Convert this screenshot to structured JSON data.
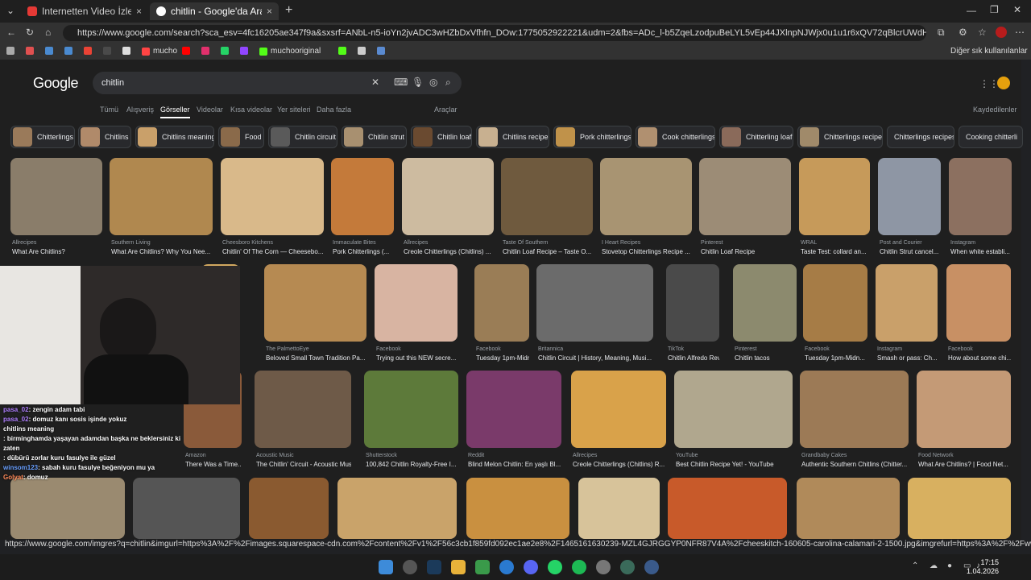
{
  "browser": {
    "tabs": [
      {
        "title": "Internetten Video İzleyerek Yemek",
        "close": "×"
      },
      {
        "title": "chitlin - Google'da Ara",
        "close": "×"
      }
    ],
    "new_tab": "+",
    "url": "https://www.google.com/search?sca_esv=4fc16205ae347f9a&sxsrf=ANbL-n5-ioYn2jvADC3wHZbDxVfhfn_DOw:1775052922221&udm=2&fbs=ADc_l-b5ZqeLzodpuBeLYL5vEp44JXlnpNJWjx0u1u1r6xQV72qBlcrUWdHOeoPCw88I-KlkkbCJM6Art9Ds...",
    "bookmarks": [
      {
        "label": ""
      },
      {
        "label": ""
      },
      {
        "label": ""
      },
      {
        "label": ""
      },
      {
        "label": ""
      },
      {
        "label": ""
      },
      {
        "label": ""
      },
      {
        "label": "mucho"
      },
      {
        "label": ""
      },
      {
        "label": ""
      },
      {
        "label": ""
      },
      {
        "label": ""
      },
      {
        "label": "muchooriginal"
      },
      {
        "label": ""
      },
      {
        "label": ""
      },
      {
        "label": ""
      }
    ],
    "other_bookmarks": "Diğer sık kullanılanlar"
  },
  "google": {
    "logo": "Google",
    "query": "chitlin",
    "nav": [
      "Tümü",
      "Alışveriş",
      "Görseller",
      "Videolar",
      "Kısa videolar",
      "Yer siteleri",
      "Daha fazla"
    ],
    "active_nav": "Görseller",
    "tools": "Araçlar",
    "saved": "Kaydedilenler",
    "chips": [
      "Chitterlings",
      "Chitlins",
      "Chitlins meaning",
      "Food",
      "Chitlin circuit",
      "Chitlin strut",
      "Chitlin loaf",
      "Chitlins recipe",
      "Pork chitterlings",
      "Cook chitterlings",
      "Chitterling loaf",
      "Chitterlings recipe",
      "Chitterlings recipes",
      "Cooking chitterli"
    ],
    "row1": [
      {
        "src": "Allrecipes",
        "cap": "What Are Chitlins?",
        "color": "#8a7d6a"
      },
      {
        "src": "Southern Living",
        "cap": "What Are Chitlins? Why You Nee...",
        "color": "#b0884f"
      },
      {
        "src": "Cheesboro Kitchens",
        "cap": "Chitlin' Of The Corn — Cheesebo...",
        "color": "#d9b98a"
      },
      {
        "src": "Immaculate Bites",
        "cap": "Pork Chitterlings (...",
        "color": "#c47a3a"
      },
      {
        "src": "Allrecipes",
        "cap": "Creole Chitterlings (Chitlins) ...",
        "color": "#cdbba0"
      },
      {
        "src": "Taste Of Southern",
        "cap": "Chitlin Loaf Recipe – Taste O...",
        "color": "#6f5a3e"
      },
      {
        "src": "I Heart Recipes",
        "cap": "Stovetop Chitterlings Recipe ...",
        "color": "#a89472"
      },
      {
        "src": "Pinterest",
        "cap": "Chitlin Loaf Recipe",
        "color": "#9c8c76"
      },
      {
        "src": "WRAL",
        "cap": "Taste Test: collard an...",
        "color": "#c69a5a"
      },
      {
        "src": "Post and Courier",
        "cap": "Chitlin Strut cancel...",
        "color": "#8e96a4"
      },
      {
        "src": "Instagram",
        "cap": "When white establi...",
        "color": "#8c7060"
      }
    ],
    "row2": [
      {
        "src": "",
        "cap": "orn",
        "color": "#d2a860"
      },
      {
        "src": "The PalmettoEye",
        "cap": "Beloved Small Town Tradition Pa...",
        "color": "#b68a52"
      },
      {
        "src": "Facebook",
        "cap": "Trying out this NEW secre...",
        "color": "#d8b4a2"
      },
      {
        "src": "Facebook",
        "cap": "Tuesday 1pm-Midn...",
        "color": "#9a7d56"
      },
      {
        "src": "Britannica",
        "cap": "Chitlin Circuit | History, Meaning, Musi...",
        "color": "#6b6b6b"
      },
      {
        "src": "TikTok",
        "cap": "Chitlin Alfredo Revi...",
        "color": "#4a4a4a"
      },
      {
        "src": "Pinterest",
        "cap": "Chitlin tacos",
        "color": "#8c8a6e"
      },
      {
        "src": "Facebook",
        "cap": "Tuesday 1pm-Midn...",
        "color": "#a67c46"
      },
      {
        "src": "Instagram",
        "cap": "Smash or pass: Ch...",
        "color": "#c9a06a"
      },
      {
        "src": "Facebook",
        "cap": "How about some chi...",
        "color": "#c89064"
      }
    ],
    "row3": [
      {
        "src": "Amazon",
        "cap": "There Was a Time...",
        "color": "#8a5a3a"
      },
      {
        "src": "Acoustic Music",
        "cap": "The Chitlin' Circuit - Acoustic Music",
        "color": "#6e5a48"
      },
      {
        "src": "Shutterstock",
        "cap": "100,842 Chitlin Royalty-Free I...",
        "color": "#5d7a3a"
      },
      {
        "src": "Reddit",
        "cap": "Blind Melon Chitlin: En yaşlı Bl...",
        "color": "#7a3a6a"
      },
      {
        "src": "Allrecipes",
        "cap": "Creole Chitterlings (Chitlins) R...",
        "color": "#d9a24a"
      },
      {
        "src": "YouTube",
        "cap": "Best Chitlin Recipe Yet! - YouTube",
        "color": "#b0a78e"
      },
      {
        "src": "Grandbaby Cakes",
        "cap": "Authentic Southern Chitlins (Chitter...",
        "color": "#9c7a56"
      },
      {
        "src": "Food Network",
        "cap": "What Are Chitlins? | Food Net...",
        "color": "#c49a76"
      }
    ],
    "row4": [
      {
        "color": "#9a8a70"
      },
      {
        "color": "#555555"
      },
      {
        "color": "#8a5a30"
      },
      {
        "color": "#c9a36a"
      },
      {
        "color": "#c99040"
      },
      {
        "color": "#d7c39a"
      },
      {
        "color": "#c85a2a"
      },
      {
        "color": "#b08a5a"
      },
      {
        "color": "#d8b060"
      }
    ]
  },
  "chat": [
    {
      "user": "pasa_02",
      "msg": ": zengin adam tabi",
      "color": "#b080ff"
    },
    {
      "user": "pasa_02",
      "msg": ": domuz kanı sosis işinde yokuz",
      "color": "#b080ff"
    },
    {
      "user": "",
      "msg": "chitlins meaning",
      "color": "#ffffff"
    },
    {
      "user": "",
      "msg": ": birminghamda yaşayan adamdan başka ne beklersiniz ki",
      "color": "#6aa0ff"
    },
    {
      "user": "",
      "msg": "zaten",
      "color": "#ffffff"
    },
    {
      "user": "",
      "msg": ": dübürü zorlar kuru fasulye ile güzel",
      "color": "#ff7070"
    },
    {
      "user": "winsom123",
      "msg": ": sabah kuru fasulye beğeniyon mu ya",
      "color": "#6aa0ff"
    },
    {
      "user": "Golyat",
      "msg": ": domuz",
      "color": "#ff8a5a"
    }
  ],
  "status_url": "https://www.google.com/imgres?q=chitlin&imgurl=https%3A%2F%2Fimages.squarespace-cdn.com%2Fcontent%2Fv1%2F56c3cb1f859fd092ec1ae2e8%2F1465161630239-MZL4GJRGGYP0NFR87V4A%2Fcheeskitch-160605-carolina-calamari-2-1500.jpg&imgrefurl=https%3A%2F%2Fwww.cheeseborokit...",
  "clock": {
    "time": "17:15",
    "date": "1.04.2026"
  }
}
